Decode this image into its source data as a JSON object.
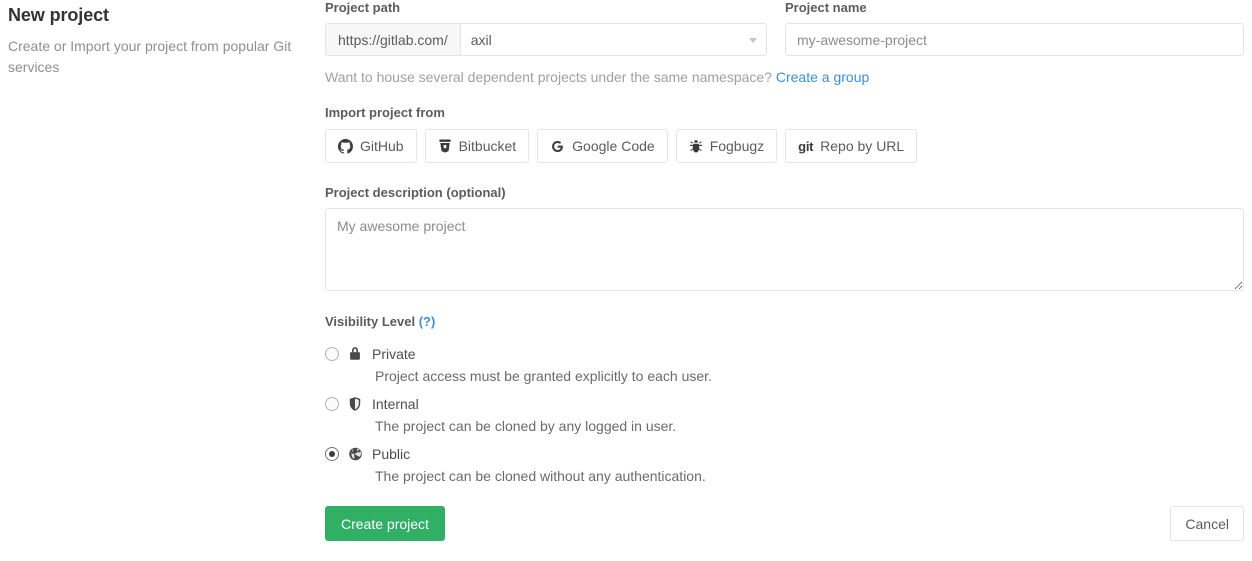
{
  "intro": {
    "title": "New project",
    "subtitle": "Create or Import your project from popular Git services"
  },
  "project_path": {
    "label": "Project path",
    "prefix": "https://gitlab.com/",
    "namespace_value": "axil",
    "caret_icon": "chevron-down-icon"
  },
  "project_name": {
    "label": "Project name",
    "placeholder": "my-awesome-project",
    "value": ""
  },
  "namespace_hint": {
    "text": "Want to house several dependent projects under the same namespace?",
    "link_label": "Create a group"
  },
  "import": {
    "label": "Import project from",
    "buttons": [
      {
        "label": "GitHub",
        "icon": "github-icon"
      },
      {
        "label": "Bitbucket",
        "icon": "bitbucket-icon"
      },
      {
        "label": "Google Code",
        "icon": "google-icon"
      },
      {
        "label": "Fogbugz",
        "icon": "bug-icon"
      },
      {
        "label": "Repo by URL",
        "icon": "git-icon",
        "icon_text": "git"
      }
    ]
  },
  "description": {
    "label": "Project description (optional)",
    "placeholder": "My awesome project",
    "value": ""
  },
  "visibility": {
    "label": "Visibility Level",
    "help_label": "(?)",
    "options": [
      {
        "name": "Private",
        "description": "Project access must be granted explicitly to each user.",
        "icon": "lock-icon",
        "selected": false
      },
      {
        "name": "Internal",
        "description": "The project can be cloned by any logged in user.",
        "icon": "shield-icon",
        "selected": false
      },
      {
        "name": "Public",
        "description": "The project can be cloned without any authentication.",
        "icon": "globe-icon",
        "selected": true
      }
    ]
  },
  "actions": {
    "create_label": "Create project",
    "cancel_label": "Cancel"
  },
  "colors": {
    "primary_green": "#31af64",
    "link_blue": "#3b8fd4",
    "border": "#e5e5e5",
    "text": "#4c4e54",
    "muted": "#8f8f8f"
  }
}
